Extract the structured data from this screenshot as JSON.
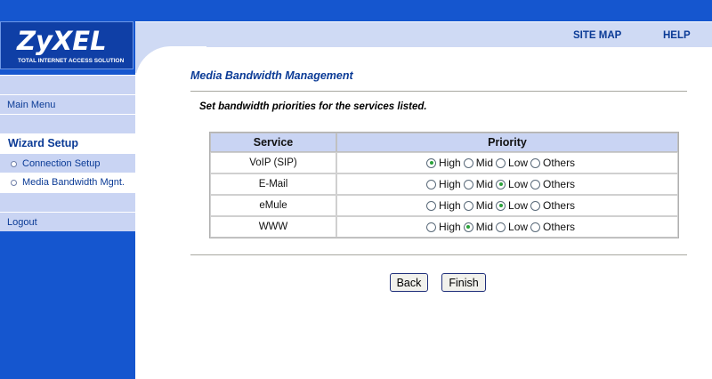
{
  "brand": {
    "logo": "ZyXEL",
    "tagline": "TOTAL INTERNET ACCESS SOLUTION"
  },
  "nav": {
    "site_map": "SITE MAP",
    "help": "HELP"
  },
  "sidebar": {
    "main_menu": "Main Menu",
    "section": "Wizard Setup",
    "items": [
      {
        "label": "Connection Setup"
      },
      {
        "label": "Media Bandwidth Mgnt."
      }
    ],
    "logout": "Logout"
  },
  "page": {
    "title": "Media Bandwidth Management",
    "instruction": "Set bandwidth priorities for the services listed."
  },
  "table": {
    "headers": {
      "service": "Service",
      "priority": "Priority"
    },
    "options": [
      "High",
      "Mid",
      "Low",
      "Others"
    ],
    "rows": [
      {
        "service": "VoIP (SIP)",
        "selected": "High"
      },
      {
        "service": "E-Mail",
        "selected": "Low"
      },
      {
        "service": "eMule",
        "selected": "Low"
      },
      {
        "service": "WWW",
        "selected": "Mid"
      }
    ]
  },
  "buttons": {
    "back": "Back",
    "finish": "Finish"
  },
  "colors": {
    "brand_blue": "#1556cf",
    "light_band": "#cfdaf4",
    "link_blue": "#0b3b96",
    "selected_dot": "#2aa13a"
  }
}
